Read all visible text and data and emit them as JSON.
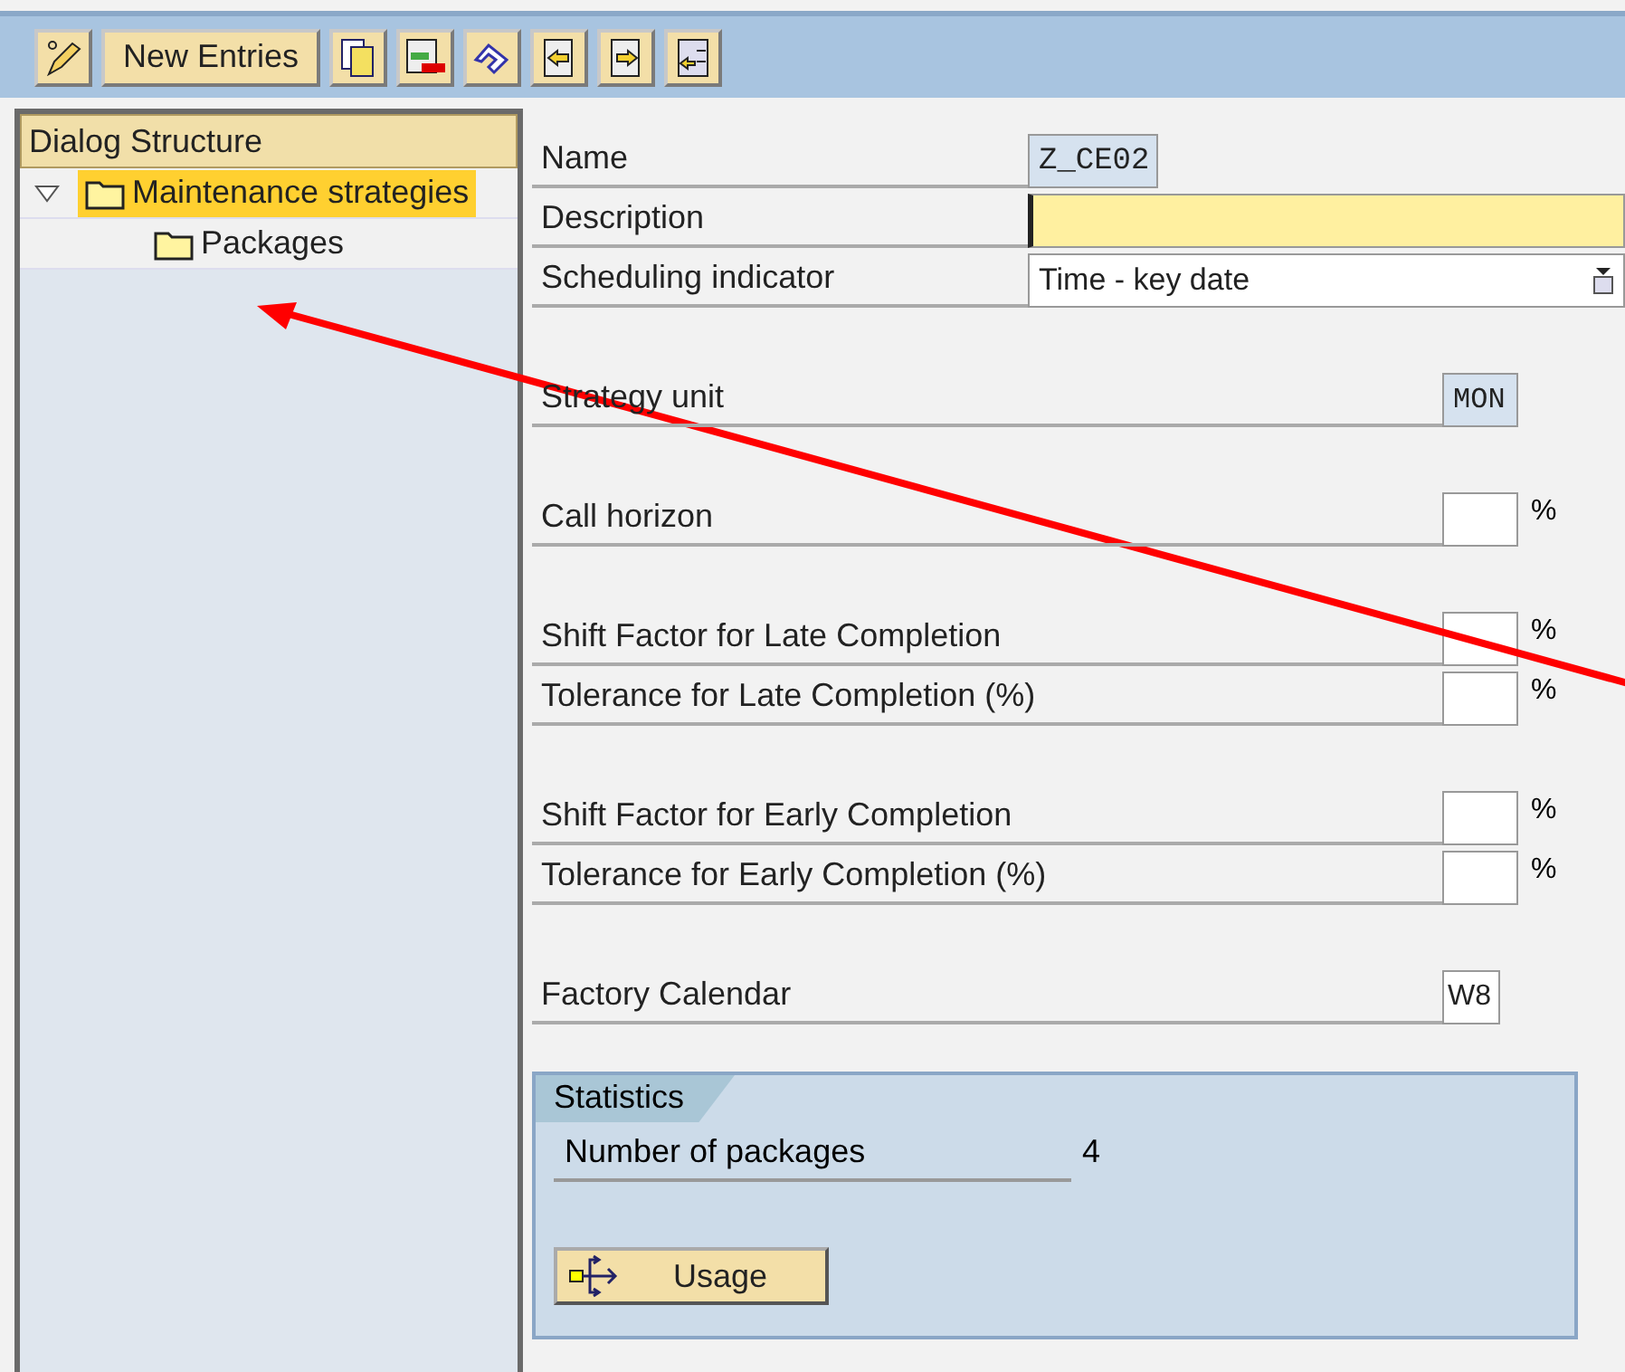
{
  "toolbar": {
    "buttons": [
      {
        "kind": "icon"
      },
      {
        "kind": "text",
        "label": "New Entries"
      },
      {
        "kind": "icon"
      },
      {
        "kind": "icon"
      },
      {
        "kind": "icon"
      },
      {
        "kind": "icon"
      },
      {
        "kind": "icon"
      },
      {
        "kind": "icon"
      }
    ]
  },
  "dialog_structure": {
    "title": "Dialog Structure",
    "items": [
      {
        "label": "Maintenance strategies",
        "selected": true,
        "expanded": true,
        "children": [
          {
            "label": "Packages",
            "selected": false
          }
        ]
      }
    ]
  },
  "form": {
    "groups": [
      [
        {
          "label": "Name",
          "kind": "display",
          "value": "Z_CE02"
        },
        {
          "label": "Description",
          "kind": "input"
        },
        {
          "label": "Scheduling indicator",
          "kind": "dropdown",
          "value": "Time - key date"
        }
      ],
      [
        {
          "label": "Strategy unit",
          "kind": "short_display",
          "value": "MON"
        }
      ],
      [
        {
          "label": "Call horizon",
          "kind": "short",
          "unit": "%"
        }
      ],
      [
        {
          "label": "Shift Factor for Late Completion",
          "kind": "short",
          "unit": "%"
        },
        {
          "label": "Tolerance for Late Completion (%)",
          "kind": "short",
          "unit": "%"
        }
      ],
      [
        {
          "label": "Shift Factor for Early Completion",
          "kind": "short",
          "unit": "%"
        },
        {
          "label": "Tolerance for Early Completion (%)",
          "kind": "short",
          "unit": "%"
        }
      ],
      [
        {
          "label": "Factory Calendar",
          "kind": "tiny",
          "value": "W8"
        }
      ]
    ]
  },
  "statistics": {
    "title": "Statistics",
    "label": "Number of packages",
    "value": "4",
    "button": "Usage"
  }
}
